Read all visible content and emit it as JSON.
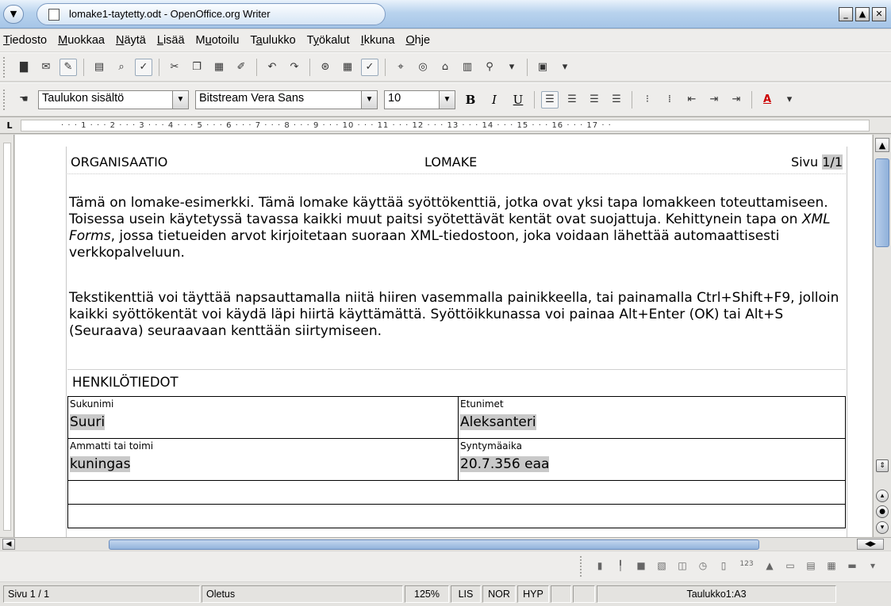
{
  "window": {
    "title": "lomake1-taytetty.odt - OpenOffice.org Writer",
    "menu_icon": "chevron-down-icon",
    "min_label": "_",
    "max_label": "▲",
    "close_label": "✕"
  },
  "menubar": {
    "items": [
      {
        "pre": "",
        "acc": "T",
        "post": "iedosto"
      },
      {
        "pre": "",
        "acc": "M",
        "post": "uokkaa"
      },
      {
        "pre": "",
        "acc": "N",
        "post": "äytä"
      },
      {
        "pre": "",
        "acc": "L",
        "post": "isää"
      },
      {
        "pre": "M",
        "acc": "u",
        "post": "otoilu"
      },
      {
        "pre": "T",
        "acc": "a",
        "post": "ulukko"
      },
      {
        "pre": "T",
        "acc": "y",
        "post": "ökalut"
      },
      {
        "pre": "",
        "acc": "I",
        "post": "kkuna"
      },
      {
        "pre": "",
        "acc": "O",
        "post": "hje"
      }
    ]
  },
  "format_toolbar": {
    "style_value": "Taulukon sisältö",
    "font_value": "Bitstream Vera Sans",
    "size_value": "10",
    "bold": "B",
    "italic": "I",
    "underline": "U",
    "font_color": "A"
  },
  "ruler": {
    "corner": "L",
    "ticks": "· · · 1 · · · 2 · · · 3 · · · 4 · · · 5 · · · 6 · · · 7 · · · 8 · · · 9 · · · 10 · · · 11 · · · 12 · · · 13 · · · 14 · · · 15 · · · 16 · · · 17 · ·"
  },
  "document": {
    "header": {
      "left": "ORGANISAATIO",
      "center": "LOMAKE",
      "page_prefix": "Sivu ",
      "page_field": "1/1"
    },
    "paragraph1_parts": {
      "before": "Tämä on lomake-esimerkki. Tämä lomake käyttää syöttökenttiä, jotka ovat yksi tapa lomakkeen toteuttamiseen. Toisessa usein käytetyssä tavassa kaikki muut paitsi syötettävät kentät ovat suojattuja. Kehittynein tapa on ",
      "italic": "XML Forms",
      "after": ", jossa tietueiden arvot kirjoitetaan suoraan XML-tiedostoon, joka voidaan lähettää automaattisesti verkkopalveluun."
    },
    "paragraph2": "Tekstikenttiä voi täyttää napsauttamalla niitä hiiren vasemmalla painikkeella, tai painamalla Ctrl+Shift+F9, jolloin kaikki syöttökentät voi käydä läpi hiirtä käyttämättä. Syöttöikkunassa voi painaa Alt+Enter (OK) tai Alt+S (Seuraava) seuraavaan kenttään siirtymiseen.",
    "section_title": "HENKILÖTIEDOT",
    "fields": {
      "surname_label": "Sukunimi",
      "surname_value": "Suuri",
      "firstname_label": "Etunimet",
      "firstname_value": "Aleksanteri",
      "occupation_label": "Ammatti tai toimi",
      "occupation_value": "kuningas",
      "birthdate_label": "Syntymäaika",
      "birthdate_value": "20.7.356 eaa"
    }
  },
  "statusbar": {
    "page": "Sivu 1 / 1",
    "style": "Oletus",
    "zoom": "125%",
    "insert_mode": "LIS",
    "selection_mode": "NOR",
    "hyperlink_mode": "HYP",
    "cell": "Taulukko1:A3"
  },
  "bottom_toolbar": {
    "number_label": "123"
  }
}
